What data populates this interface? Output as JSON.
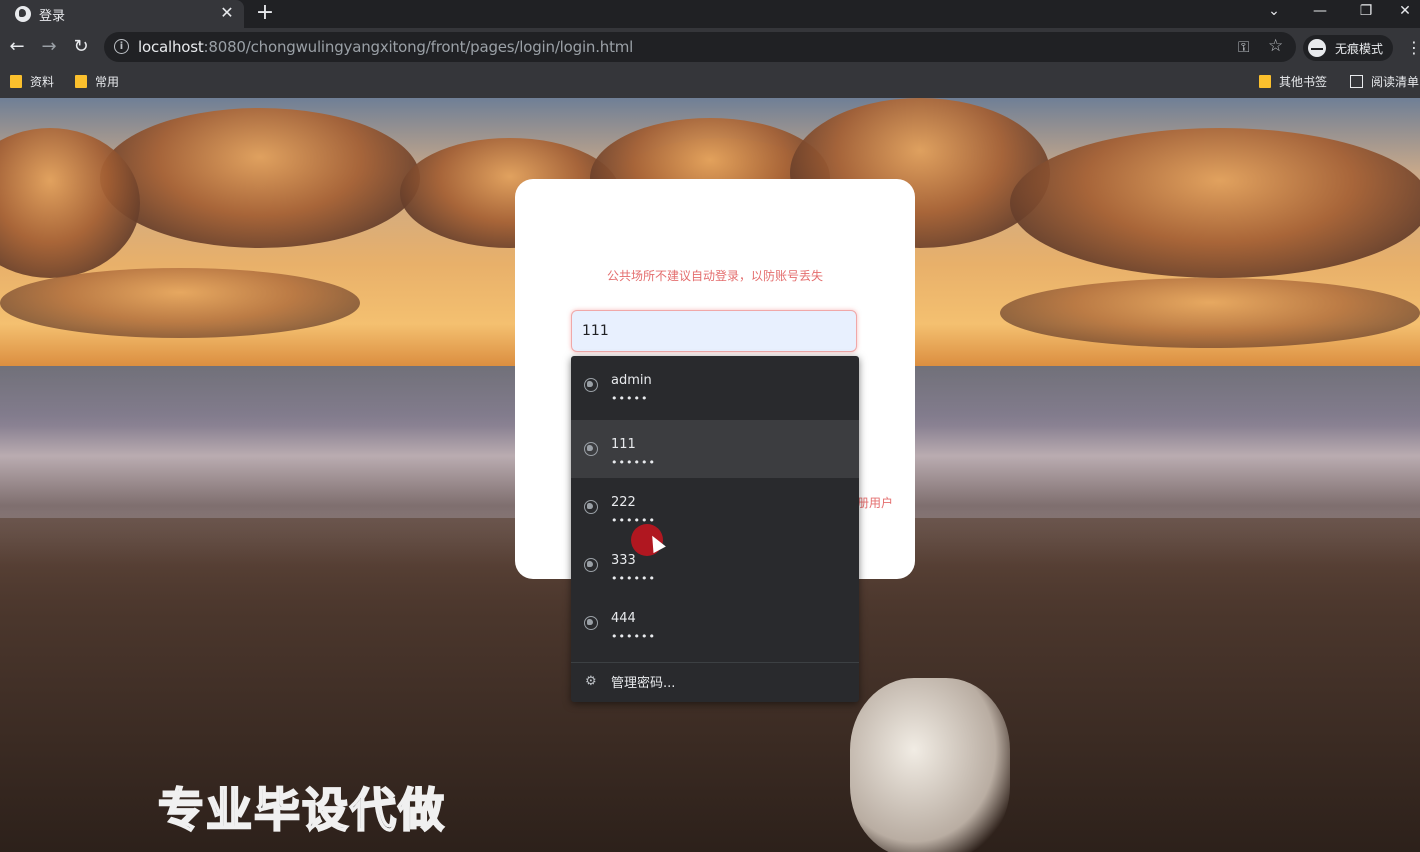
{
  "browser": {
    "tab_title": "登录",
    "tab_close": "✕",
    "new_tab": "+",
    "url_host": "localhost",
    "url_rest": ":8080/chongwulingyangxitong/front/pages/login/login.html",
    "incognito_label": "无痕模式",
    "window_controls": {
      "dropdown": "⌄",
      "minimize": "—",
      "restore": "❐",
      "close": "✕"
    }
  },
  "bookmarks": {
    "left": [
      "资料",
      "常用"
    ],
    "other": "其他书签",
    "reading_list": "阅读清单"
  },
  "login": {
    "warning": "公共场所不建议自动登录，以防账号丢失",
    "username_value": "111",
    "register_link": "册用户"
  },
  "autofill": {
    "items": [
      {
        "user": "admin",
        "pass": "•••••"
      },
      {
        "user": "111",
        "pass": "••••••"
      },
      {
        "user": "222",
        "pass": "••••••"
      },
      {
        "user": "333",
        "pass": "••••••"
      },
      {
        "user": "444",
        "pass": "••••••"
      }
    ],
    "manage": "管理密码..."
  },
  "watermark": "专业毕设代做",
  "colors": {
    "accent_warning": "#e46e6e",
    "autofill_bg": "#292a2d",
    "chrome_dark": "#35363a"
  }
}
